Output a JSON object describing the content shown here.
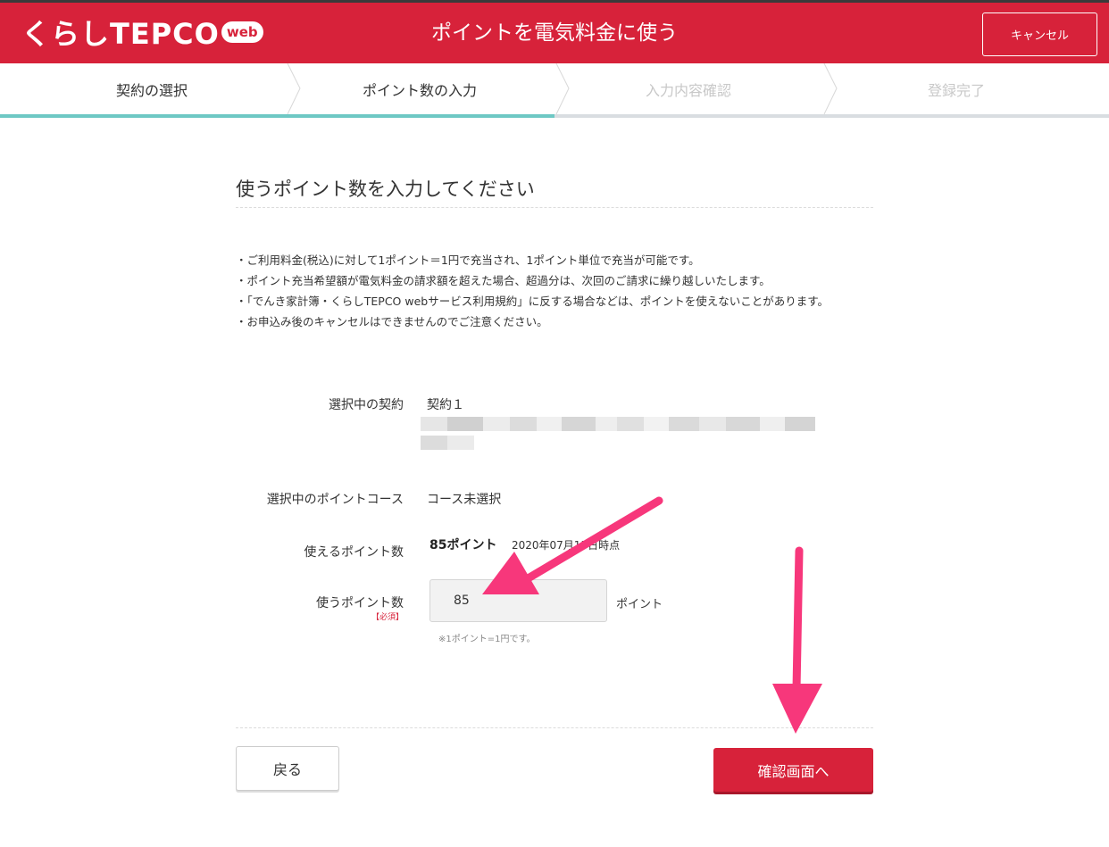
{
  "header": {
    "logo_text": "くらしTEPCO",
    "logo_badge": "web",
    "title": "ポイントを電気料金に使う",
    "cancel_label": "キャンセル",
    "brand_color": "#d7223a"
  },
  "steps": [
    {
      "label": "契約の選択",
      "state": "done"
    },
    {
      "label": "ポイント数の入力",
      "state": "current"
    },
    {
      "label": "入力内容確認",
      "state": "pending"
    },
    {
      "label": "登録完了",
      "state": "pending"
    }
  ],
  "progress": {
    "completed_fraction": 0.5,
    "color": "#6ec8c4"
  },
  "main": {
    "title": "使うポイント数を入力してください",
    "notes": [
      "・ご利用料金(税込)に対して1ポイント＝1円で充当され、1ポイント単位で充当が可能です。",
      "・ポイント充当希望額が電気料金の請求額を超えた場合、超過分は、次回のご請求に繰り越しいたします。",
      "・「でんき家計簿・くらしTEPCO webサービス利用規約」に反する場合などは、ポイントを使えないことがあります。",
      "・お申込み後のキャンセルはできませんのでご注意ください。"
    ]
  },
  "form": {
    "contract_label": "選択中の契約",
    "contract_value": "契約１",
    "course_label": "選択中のポイントコース",
    "course_value": "コース未選択",
    "available_label": "使えるポイント数",
    "available_value": "85ポイント",
    "available_date": "2020年07月15日時点",
    "use_label": "使うポイント数",
    "required_label": "【必須】",
    "use_value": "85",
    "unit": "ポイント",
    "hint": "※1ポイント=1円です。"
  },
  "footer": {
    "back_label": "戻る",
    "confirm_label": "確認画面へ"
  },
  "annotation": {
    "arrow_color": "#f7377b"
  }
}
